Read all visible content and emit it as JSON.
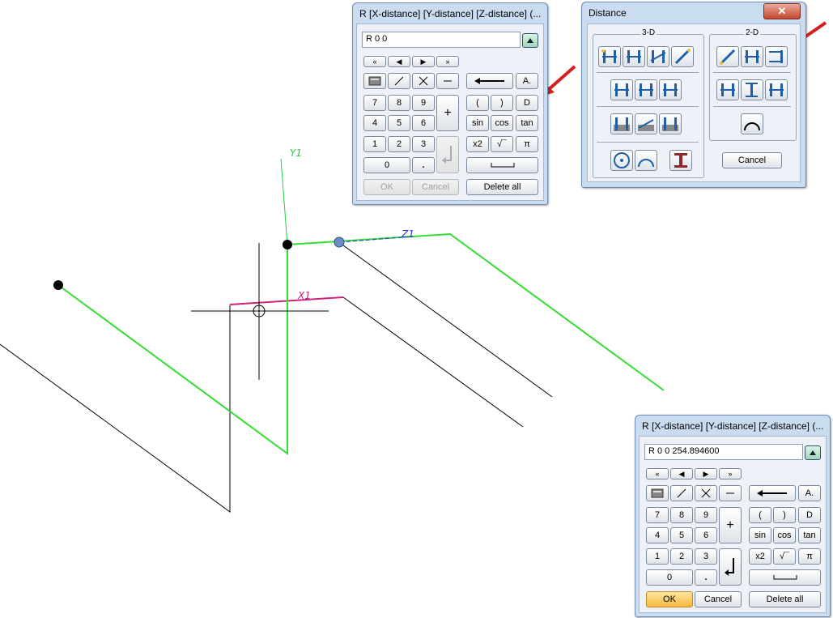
{
  "viewport": {
    "axis_labels": {
      "y": "Y1",
      "z": "Z1",
      "x": "X1"
    },
    "colors": {
      "green_edge": "#33dd33",
      "magenta_edge": "#cc2277",
      "black_edge": "#000000",
      "axis_green": "#22cc44",
      "axis_blue": "#2233cc"
    }
  },
  "calc1": {
    "title": "R [X-distance] [Y-distance] [Z-distance] (...",
    "input_value": "R 0 0",
    "nav": [
      "«",
      "◀",
      "▶",
      "»"
    ],
    "keys": {
      "k7": "7",
      "k8": "8",
      "k9": "9",
      "k4": "4",
      "k5": "5",
      "k6": "6",
      "k1": "1",
      "k2": "2",
      "k3": "3",
      "k0": "0",
      "dot": ".",
      "plus": "+",
      "a": "A.",
      "lparen": "(",
      "rparen": ")",
      "d": "D",
      "sin": "sin",
      "cos": "cos",
      "tan": "tan",
      "x2": "x2",
      "sqrt": "√¯",
      "pi": "π",
      "ok": "OK",
      "cancel": "Cancel",
      "delete_all": "Delete all"
    }
  },
  "calc2": {
    "title": "R [X-distance] [Y-distance] [Z-distance] (...",
    "input_value": "R 0 0 254.894600",
    "nav": [
      "«",
      "◀",
      "▶",
      "»"
    ],
    "keys": {
      "k7": "7",
      "k8": "8",
      "k9": "9",
      "k4": "4",
      "k5": "5",
      "k6": "6",
      "k1": "1",
      "k2": "2",
      "k3": "3",
      "k0": "0",
      "dot": ".",
      "plus": "+",
      "a": "A.",
      "lparen": "(",
      "rparen": ")",
      "d": "D",
      "sin": "sin",
      "cos": "cos",
      "tan": "tan",
      "x2": "x2",
      "sqrt": "√¯",
      "pi": "π",
      "ok": "OK",
      "cancel": "Cancel",
      "delete_all": "Delete all"
    }
  },
  "distance": {
    "title": "Distance",
    "close": "✕",
    "group_3d": "3-D",
    "group_2d": "2-D",
    "cancel": "Cancel"
  },
  "annotation": {
    "arrow_color": "#d62020"
  }
}
